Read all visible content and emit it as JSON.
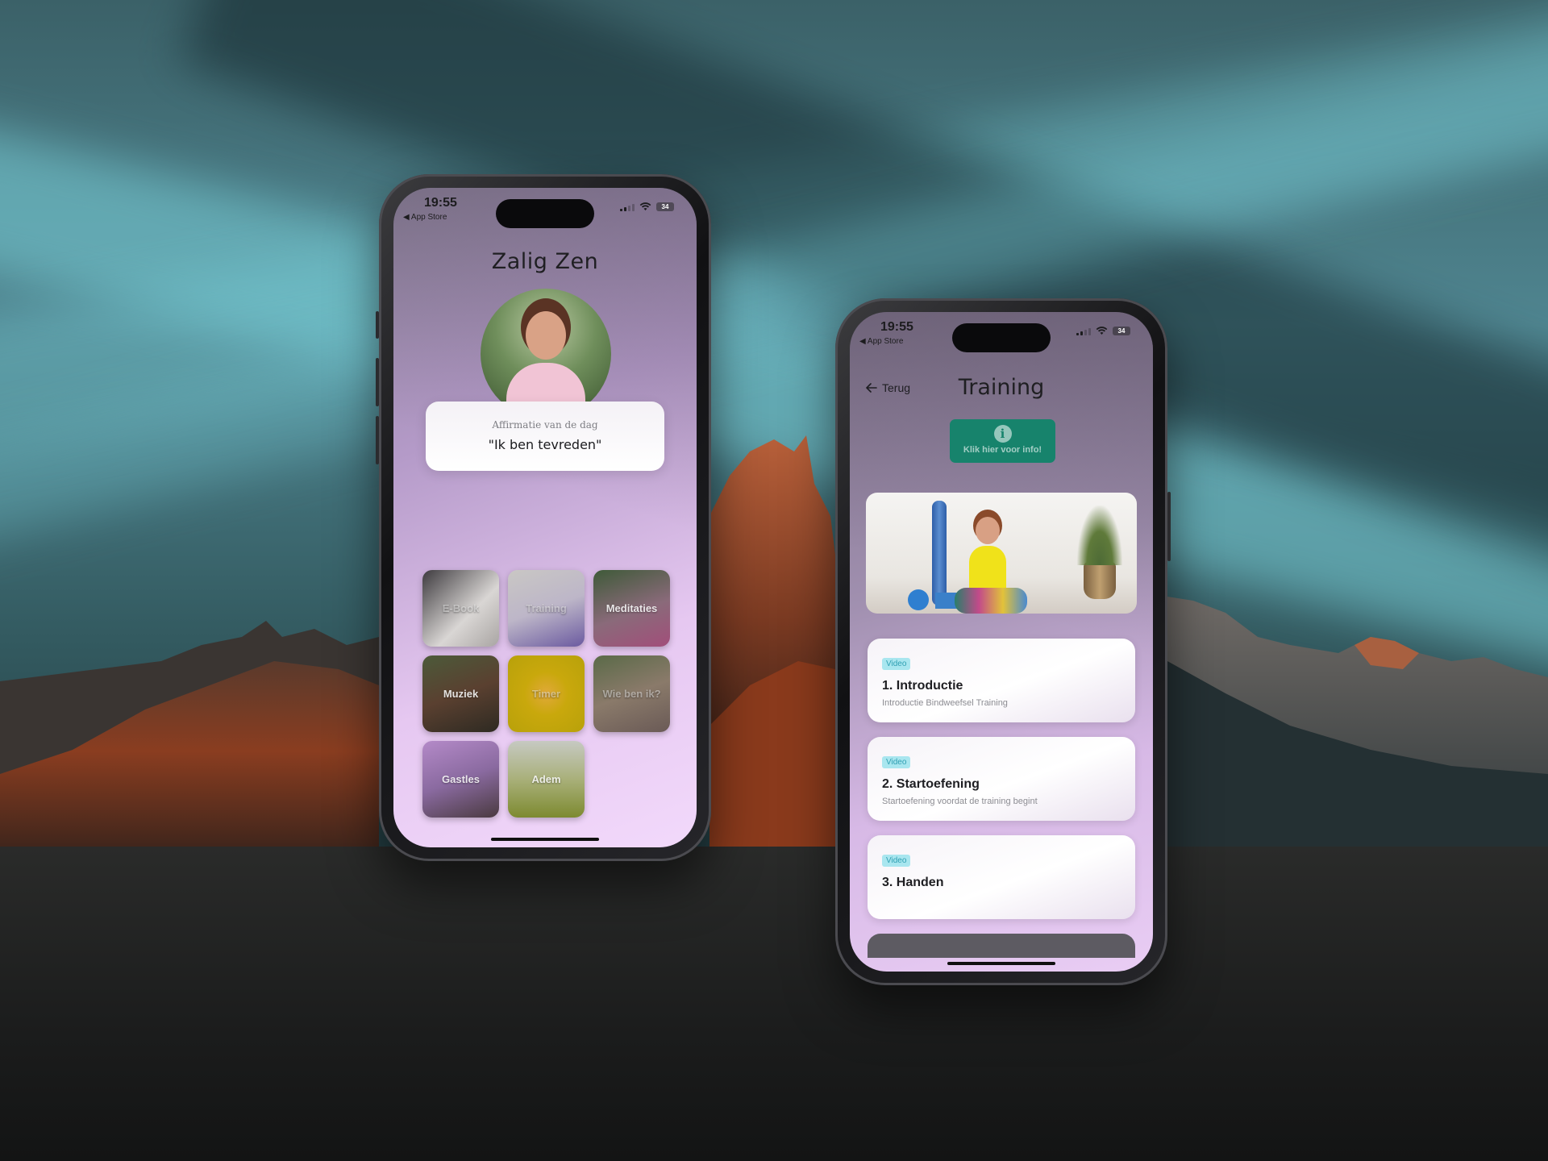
{
  "status_bar": {
    "time": "19:55",
    "back_app": "◀ App Store",
    "battery": "34"
  },
  "home": {
    "title": "Zalig Zen",
    "affirmation": {
      "label": "Affirmatie van de dag",
      "text": "\"Ik ben tevreden\""
    },
    "tiles": [
      {
        "label": "E-Book"
      },
      {
        "label": "Training"
      },
      {
        "label": "Meditaties"
      },
      {
        "label": "Muziek"
      },
      {
        "label": "Timer"
      },
      {
        "label": "Wie ben ik?"
      },
      {
        "label": "Gastles"
      },
      {
        "label": "Adem"
      }
    ]
  },
  "training": {
    "back_label": "Terug",
    "title": "Training",
    "info_button": "Klik hier voor info!",
    "items": [
      {
        "tag": "Video",
        "title": "1. Introductie",
        "subtitle": "Introductie Bindweefsel Training"
      },
      {
        "tag": "Video",
        "title": "2. Startoefening",
        "subtitle": "Startoefening voordat de training begint"
      },
      {
        "tag": "Video",
        "title": "3. Handen",
        "subtitle": ""
      }
    ]
  },
  "colors": {
    "accent_green": "#17836c",
    "tag_bg": "#a9e6ef",
    "screen_pink": "#f2d9fb"
  }
}
